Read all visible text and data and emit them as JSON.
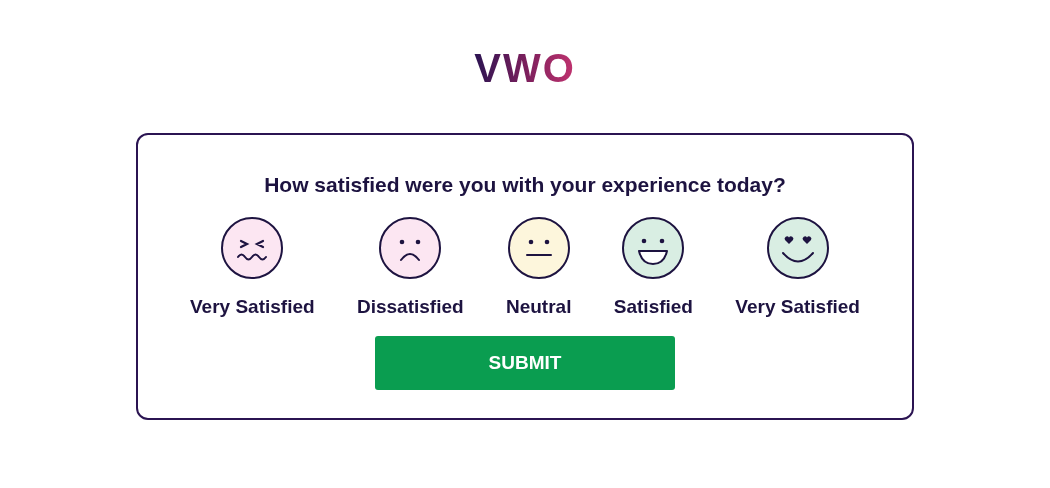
{
  "logo": "VWO",
  "survey": {
    "question": "How satisfied were you with your experience today?",
    "options": [
      {
        "label": "Very Satisfied",
        "kind": "scrunched",
        "color": "#fce6f2"
      },
      {
        "label": "Dissatisfied",
        "kind": "sad",
        "color": "#fce6f2"
      },
      {
        "label": "Neutral",
        "kind": "neutral",
        "color": "#fdf6dc"
      },
      {
        "label": "Satisfied",
        "kind": "grin",
        "color": "#d9eee3"
      },
      {
        "label": "Very Satisfied",
        "kind": "love",
        "color": "#d9eee3"
      }
    ],
    "submit": "SUBMIT"
  }
}
